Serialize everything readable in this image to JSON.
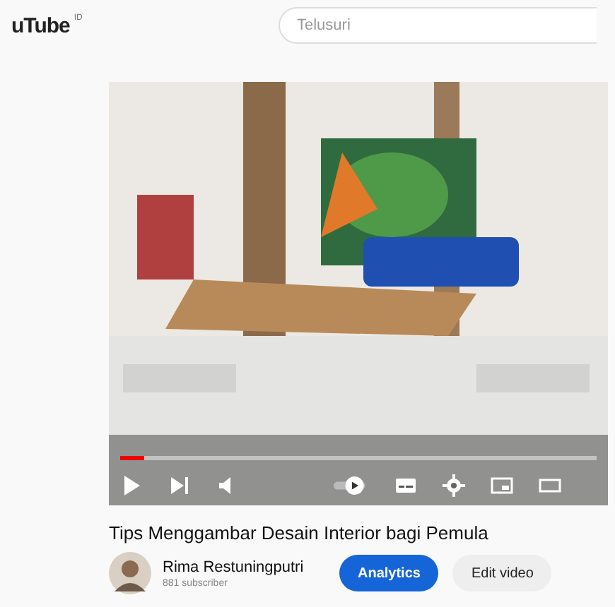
{
  "header": {
    "logo": "uTube",
    "region": "ID",
    "search": {
      "placeholder": "Telusuri"
    }
  },
  "player": {
    "kind": "picture",
    "progress": {
      "level": 0.05
    },
    "controls": [
      {
        "kind": "play"
      },
      {
        "kind": "next"
      },
      {
        "kind": "volume"
      },
      {
        "kind": "autoplay"
      },
      {
        "kind": "subtitles"
      },
      {
        "kind": "settings"
      },
      {
        "kind": "miniplayer"
      },
      {
        "kind": "theater"
      }
    ]
  },
  "video": {
    "title": "Tips Menggambar Desain Interior bagi Pemula",
    "channel": "Rima Restuningputri",
    "subscribers": "881 subscriber",
    "buttons": [
      {
        "label": "Analytics",
        "kind": "primary"
      },
      {
        "label": "Edit video",
        "kind": "secondary"
      }
    ]
  }
}
